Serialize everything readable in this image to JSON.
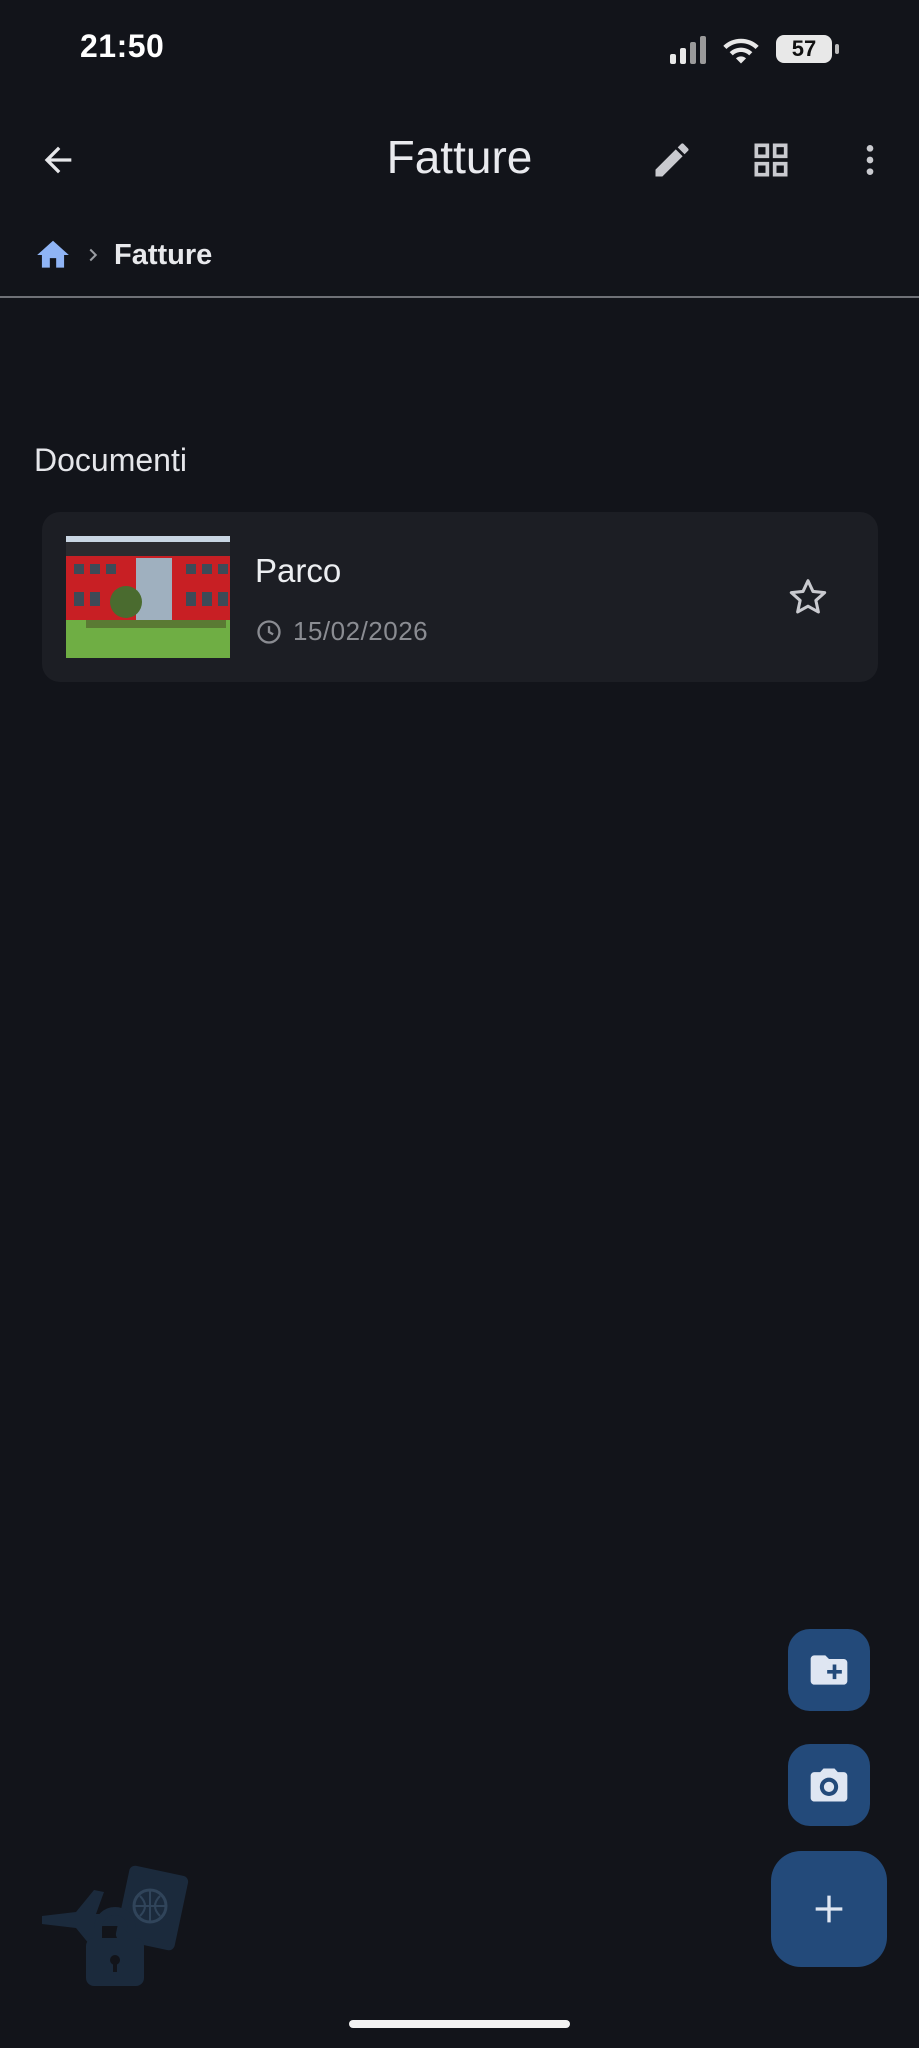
{
  "status_bar": {
    "time": "21:50",
    "battery": "57"
  },
  "app_bar": {
    "title": "Fatture",
    "icons": [
      "back-arrow-icon",
      "edit-pencil-icon",
      "grid-view-icon",
      "more-vert-icon"
    ]
  },
  "breadcrumb": {
    "current": "Fatture",
    "home_icon_color": "#8fb4f5"
  },
  "section": {
    "title": "Documenti"
  },
  "documents": [
    {
      "name": "Parco",
      "date": "15/02/2026"
    }
  ],
  "colors": {
    "background": "#12141a",
    "card": "#1c1e24",
    "fab": "#234a7a",
    "fab_icon": "#dfe6f2"
  }
}
